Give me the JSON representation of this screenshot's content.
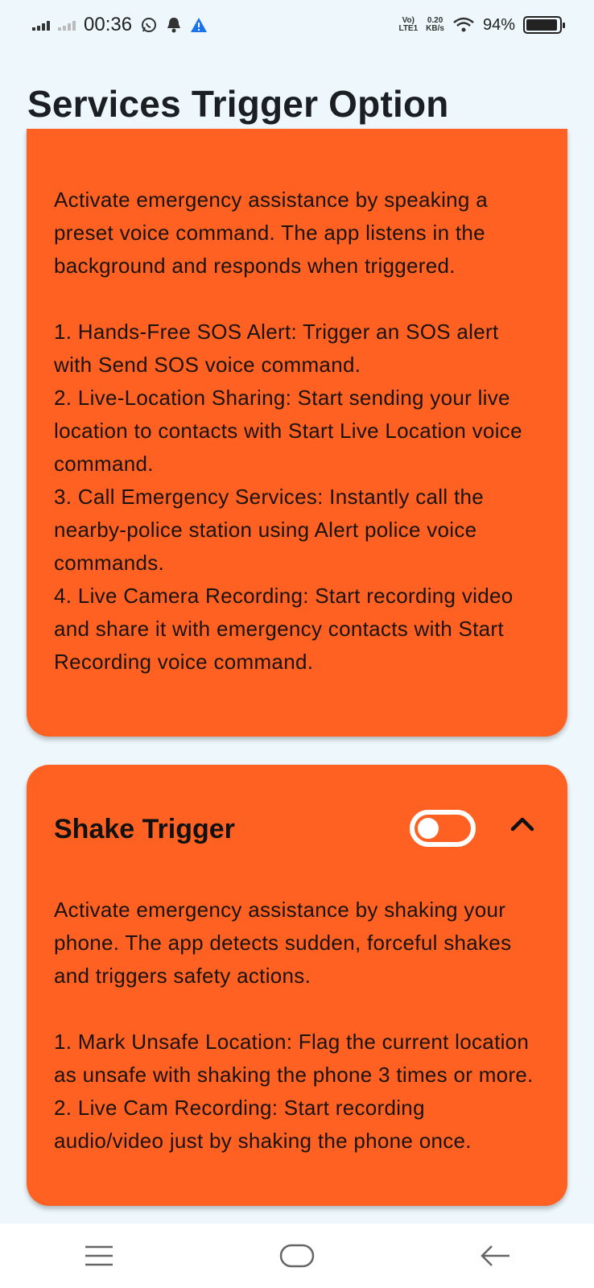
{
  "status_bar": {
    "time": "00:36",
    "network_top": "Vo)",
    "network_bottom": "LTE1",
    "speed_top": "0.20",
    "speed_bottom": "KB/s",
    "battery": "94%",
    "battery_level": 0.94
  },
  "page": {
    "title": "Services Trigger Option"
  },
  "voice_card": {
    "description": "Activate emergency assistance by speaking a preset voice command. The app listens in the background and responds when triggered.",
    "items": [
      "1. Hands-Free SOS Alert: Trigger an SOS alert with Send SOS voice command.",
      "2. Live-Location Sharing: Start sending your live location to contacts with Start Live Location voice command.",
      "3. Call Emergency Services: Instantly call the nearby-police station using Alert police voice commands.",
      "4. Live Camera Recording: Start recording video and share it with emergency contacts with Start Recording voice command."
    ]
  },
  "shake_card": {
    "heading": "Shake Trigger",
    "toggle_on": false,
    "expanded": true,
    "description": "Activate emergency assistance by shaking your phone. The app detects sudden, forceful shakes and triggers safety actions.",
    "items": [
      "1. Mark Unsafe Location: Flag the current location as unsafe with shaking the phone 3 times or more.",
      "2. Live Cam Recording: Start recording audio/video just by shaking the phone once."
    ]
  },
  "colors": {
    "card": "#ff6122",
    "background": "#eef8fc"
  },
  "icons": [
    "whatsapp-icon",
    "notification-icon",
    "warning-icon",
    "wifi-icon",
    "menu-icon",
    "home-icon",
    "back-icon",
    "chevron-up-icon"
  ]
}
